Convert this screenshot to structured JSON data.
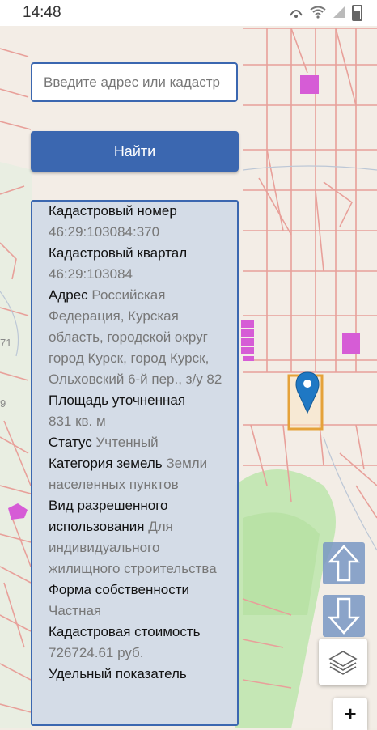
{
  "status_bar": {
    "time": "14:48"
  },
  "search": {
    "placeholder": "Введите адрес или кадастр",
    "button_label": "Найти"
  },
  "info": [
    {
      "label": "Кадастровый номер",
      "value": "46:29:103084:370"
    },
    {
      "label": "Кадастровый квартал",
      "value": "46:29:103084"
    },
    {
      "label": "Адрес",
      "value": "Российская Федерация, Курская область, городской округ город Курск, город Курск, Ольховский 6-й пер., з/у 82"
    },
    {
      "label": "Площадь уточненная",
      "value": "831 кв. м"
    },
    {
      "label": "Статус",
      "value": "Учтенный"
    },
    {
      "label": "Категория земель",
      "value": "Земли населенных пунктов"
    },
    {
      "label": "Вид разрешенного использования",
      "value": "Для индивидуального жилищного строительства"
    },
    {
      "label": "Форма собственности",
      "value": "Частная"
    },
    {
      "label": "Кадастровая стоимость",
      "value": "726724.61 руб."
    },
    {
      "label": "Удельный показатель",
      "value": ""
    }
  ],
  "map": {
    "edge_labels": [
      "71",
      "9"
    ],
    "parcel_color": "#e8a09a",
    "highlight_color": "#e5a23a",
    "marker_color": "#1f78c4",
    "building_color": "#d65cd6",
    "green_color": "#c5e7b5"
  },
  "controls": {
    "zoom_in": "+"
  }
}
